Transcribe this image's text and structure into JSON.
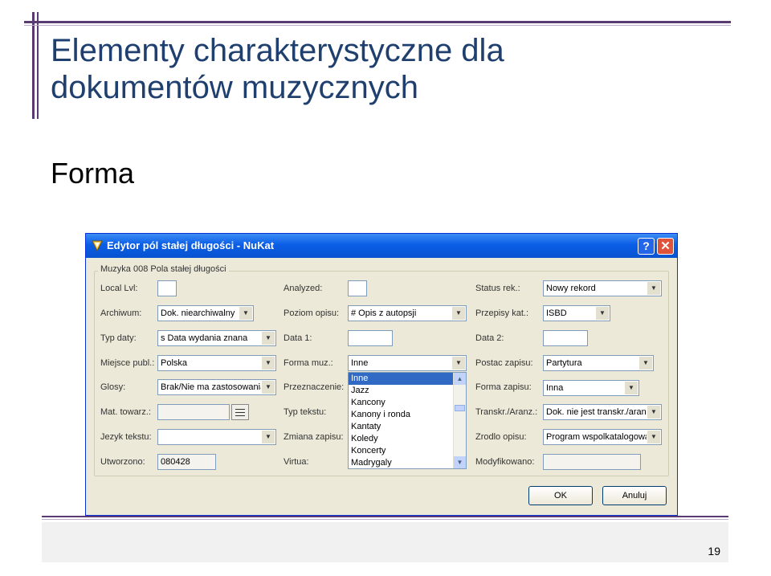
{
  "slide": {
    "title_line1": "Elementy charakterystyczne dla",
    "title_line2": "dokumentów muzycznych",
    "subtitle": "Forma",
    "page_number": "19"
  },
  "window": {
    "title": "Edytor pól stałej długości - NuKat",
    "help_label": "?",
    "close_label": "✕",
    "group_label": "Muzyka 008 Pola stałej długości"
  },
  "fields": {
    "local_lvl": {
      "label": "Local Lvl:",
      "value": ""
    },
    "analyzed": {
      "label": "Analyzed:",
      "value": ""
    },
    "status_rek": {
      "label": "Status rek.:",
      "value": "Nowy rekord"
    },
    "archiwum": {
      "label": "Archiwum:",
      "value": "Dok. niearchiwalny"
    },
    "poziom_opisu": {
      "label": "Poziom opisu:",
      "value": "# Opis z autopsji"
    },
    "przepisy_kat": {
      "label": "Przepisy kat.:",
      "value": "ISBD"
    },
    "typ_daty": {
      "label": "Typ daty:",
      "value": "s Data wydania znana"
    },
    "data1": {
      "label": "Data 1:",
      "value": ""
    },
    "data2": {
      "label": "Data 2:",
      "value": ""
    },
    "miejsce_publ": {
      "label": "Miejsce publ.:",
      "value": "Polska"
    },
    "forma_muz": {
      "label": "Forma muz.:",
      "value": "Inne"
    },
    "postac_zapisu": {
      "label": "Postac zapisu:",
      "value": "Partytura"
    },
    "glosy": {
      "label": "Glosy:",
      "value": "Brak/Nie ma zastosowania"
    },
    "przeznaczenie": {
      "label": "Przeznaczenie:",
      "value": ""
    },
    "forma_zapisu": {
      "label": "Forma zapisu:",
      "value": "Inna"
    },
    "mat_towarz": {
      "label": "Mat. towarz.:",
      "value": ""
    },
    "typ_tekstu": {
      "label": "Typ tekstu:",
      "value": ""
    },
    "transkr": {
      "label": "Transkr./Aranz.:",
      "value": "Dok. nie jest transkr./aranz"
    },
    "jezyk_tekstu": {
      "label": "Jezyk tekstu:",
      "value": ""
    },
    "zmiana_zapisu": {
      "label": "Zmiana zapisu:",
      "value": ""
    },
    "zrodlo_opisu": {
      "label": "Zrodlo opisu:",
      "value": "Program wspolkatalogowan"
    },
    "utworzono": {
      "label": "Utworzono:",
      "value": "080428"
    },
    "virtua": {
      "label": "Virtua:",
      "value": ""
    },
    "modyfikowano": {
      "label": "Modyfikowano:",
      "value": ""
    }
  },
  "forma_dropdown": {
    "options": [
      "Inne",
      "Jazz",
      "Kancony",
      "Kanony i ronda",
      "Kantaty",
      "Koledy",
      "Koncerty",
      "Madrygaly"
    ],
    "selected": "Inne"
  },
  "buttons": {
    "ok": "OK",
    "cancel": "Anuluj"
  }
}
